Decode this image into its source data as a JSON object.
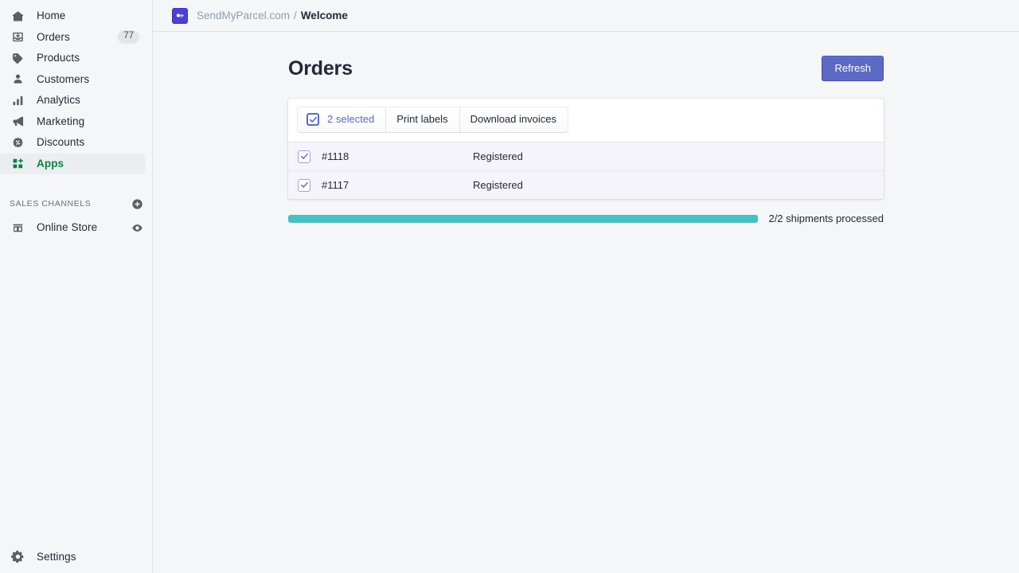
{
  "sidebar": {
    "items": [
      {
        "label": "Home",
        "icon": "home-icon",
        "badge": null,
        "active": false
      },
      {
        "label": "Orders",
        "icon": "orders-inbox-icon",
        "badge": "77",
        "active": false
      },
      {
        "label": "Products",
        "icon": "tag-icon",
        "badge": null,
        "active": false
      },
      {
        "label": "Customers",
        "icon": "person-icon",
        "badge": null,
        "active": false
      },
      {
        "label": "Analytics",
        "icon": "bar-chart-icon",
        "badge": null,
        "active": false
      },
      {
        "label": "Marketing",
        "icon": "megaphone-icon",
        "badge": null,
        "active": false
      },
      {
        "label": "Discounts",
        "icon": "discount-percent-icon",
        "badge": null,
        "active": false
      },
      {
        "label": "Apps",
        "icon": "apps-grid-plus-icon",
        "badge": null,
        "active": true
      }
    ],
    "section": {
      "title": "SALES CHANNELS",
      "add_icon": "plus-circle-icon"
    },
    "channels": [
      {
        "label": "Online Store",
        "icon": "storefront-icon",
        "action_icon": "eye-icon"
      }
    ],
    "footer": {
      "label": "Settings",
      "icon": "gear-icon"
    },
    "active_color": "#108043",
    "badge_color": "#e4e5e7"
  },
  "topbar": {
    "app_icon": "sendmyparcel-app-icon",
    "app_name": "SendMyParcel.com",
    "separator": "/",
    "current": "Welcome",
    "icon_color": "#4b40d4"
  },
  "page": {
    "title": "Orders",
    "refresh_label": "Refresh",
    "refresh_color": "#5c6ac4"
  },
  "toolbar": {
    "selected_label": "2 selected",
    "print_labels_label": "Print labels",
    "download_invoices_label": "Download invoices",
    "select_all_icon": "checkbox-checked-icon"
  },
  "table": {
    "rows": [
      {
        "order": "#1118",
        "status": "Registered",
        "checked": true
      },
      {
        "order": "#1117",
        "status": "Registered",
        "checked": true
      }
    ]
  },
  "progress": {
    "percent": 100,
    "label": "2/2 shipments processed",
    "color": "#47c1bf"
  }
}
